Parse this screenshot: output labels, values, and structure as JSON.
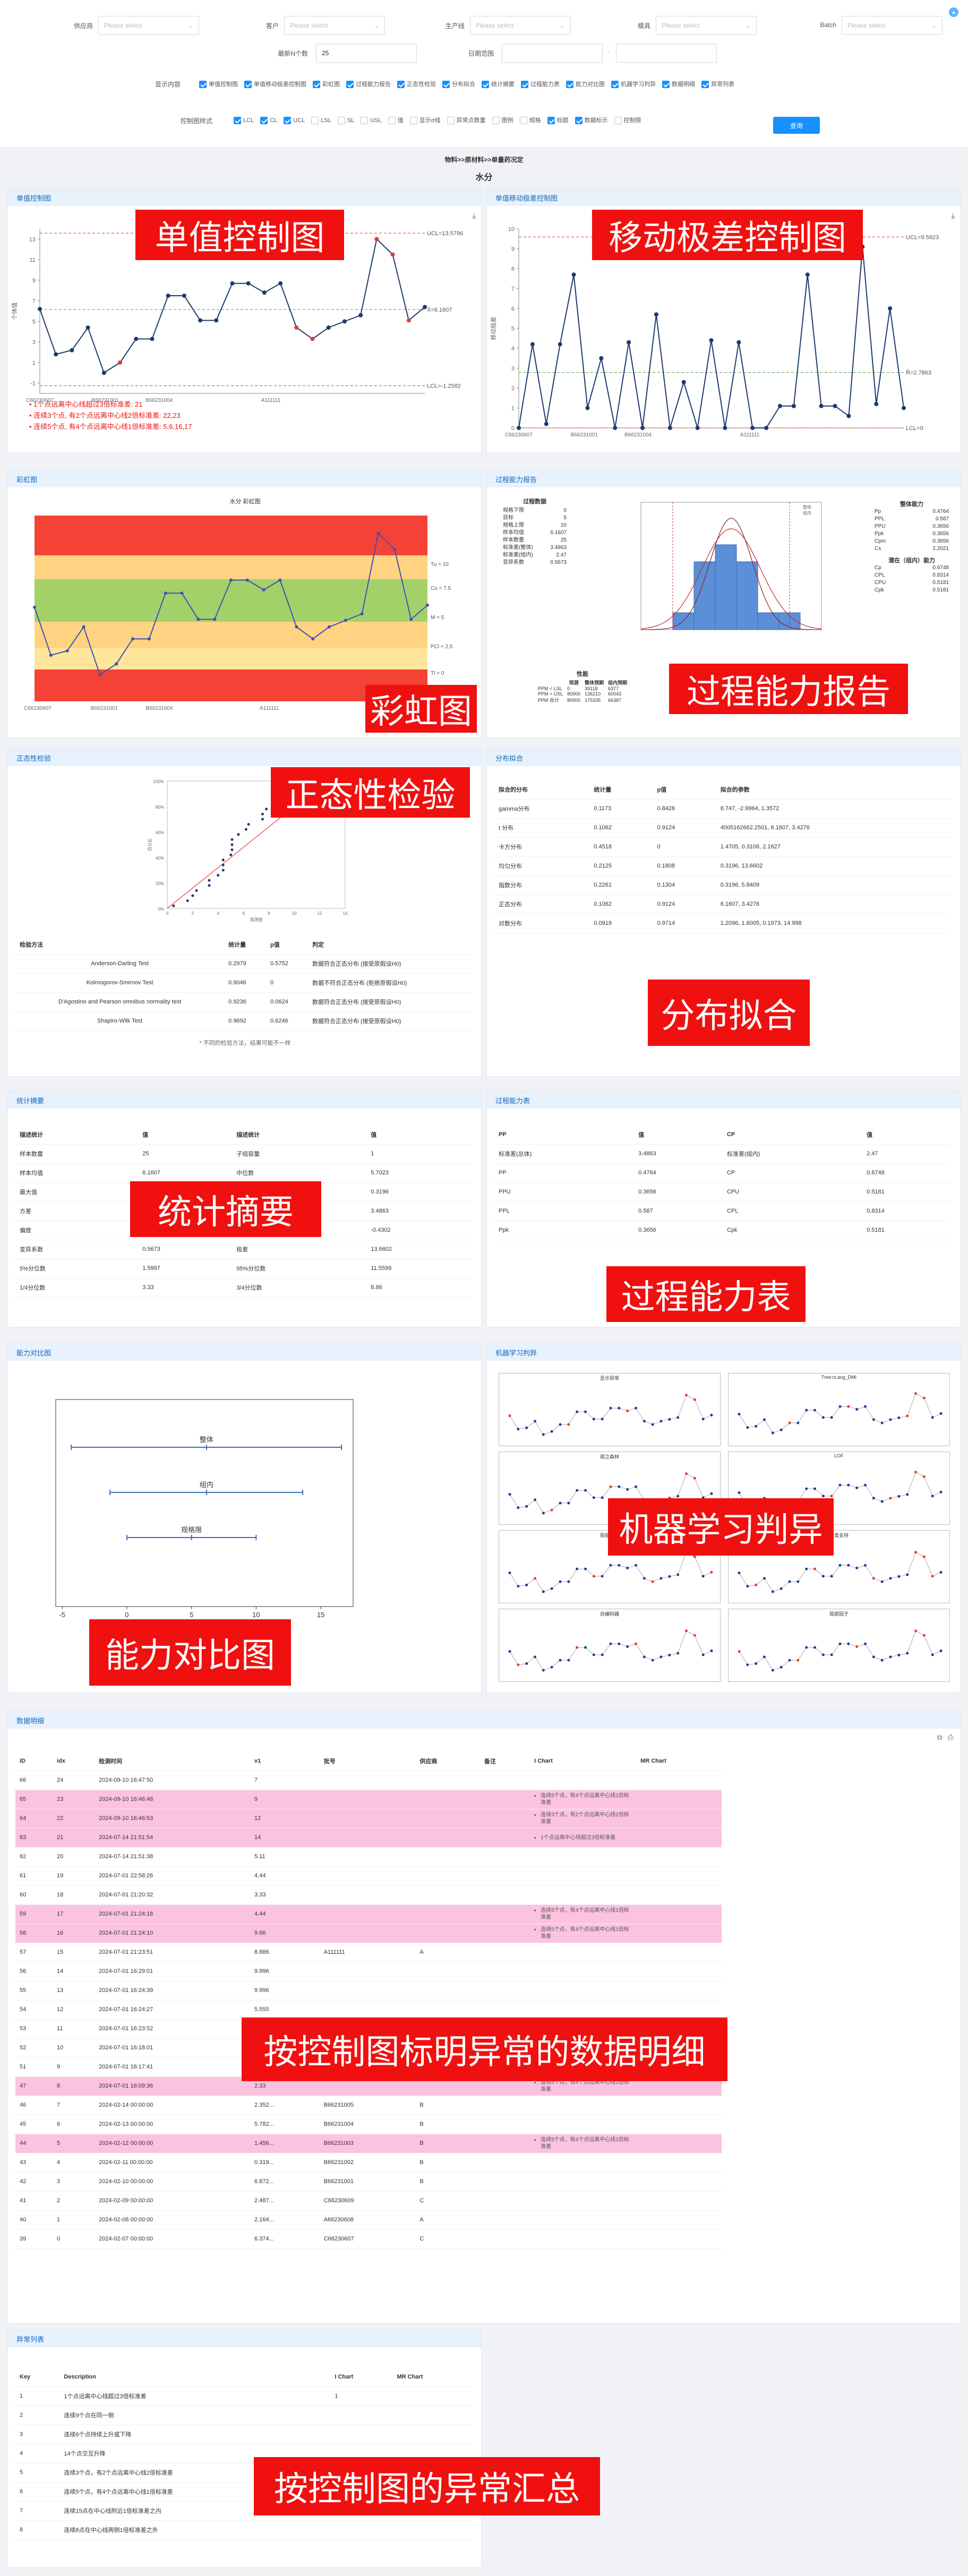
{
  "filters": {
    "row1": [
      {
        "label": "供应商",
        "placeholder": "Please select"
      },
      {
        "label": "客户",
        "placeholder": "Please select"
      },
      {
        "label": "生产线",
        "placeholder": "Please select"
      },
      {
        "label": "模具",
        "placeholder": "Please select"
      },
      {
        "label": "Batch",
        "placeholder": "Please select"
      }
    ],
    "recent_label": "最新N个数",
    "recent_value": "25",
    "date_label": "日期范围",
    "date_sep": "-",
    "display_label": "显示内容",
    "display_items": [
      "单值控制图",
      "单值移动极差控制图",
      "彩虹图",
      "过程能力报告",
      "正态性检验",
      "分布拟合",
      "统计摘要",
      "过程能力表",
      "能力对比图",
      "机器学习判异",
      "数据明细",
      "异常列表"
    ],
    "style_label": "控制图样式",
    "style_items": [
      {
        "label": "LCL",
        "on": true
      },
      {
        "label": "CL",
        "on": true
      },
      {
        "label": "UCL",
        "on": true
      },
      {
        "label": "LSL",
        "on": false
      },
      {
        "label": "SL",
        "on": false
      },
      {
        "label": "USL",
        "on": false
      },
      {
        "label": "值",
        "on": false
      },
      {
        "label": "显示σ线",
        "on": false
      },
      {
        "label": "异常点数量",
        "on": false
      },
      {
        "label": "图例",
        "on": false
      },
      {
        "label": "规格",
        "on": false
      },
      {
        "label": "标题",
        "on": true
      },
      {
        "label": "数据标示",
        "on": true
      },
      {
        "label": "控制限",
        "on": false
      }
    ],
    "query_btn": "查询"
  },
  "breadcrumb": "物料>>原材料>>单量药况定",
  "subtitle": "水分",
  "overlay_labels": {
    "i_chart": "单值控制图",
    "mr_chart": "移动极差控制图",
    "rainbow": "彩虹图",
    "capability_report": "过程能力报告",
    "normality": "正态性检验",
    "dist_fit": "分布拟合",
    "stats": "统计摘要",
    "cap_table": "过程能力表",
    "compare": "能力对比图",
    "ml": "机器学习判异",
    "detail": "按控制图标明异常的数据明细",
    "summary": "按控制图的异常汇总"
  },
  "colors": {
    "accent": "#1890ff",
    "overlay": "#f01010",
    "header_bg": "#e7f2fc",
    "pink": "#fbc3e0"
  },
  "i_chart": {
    "title": "单值控制图",
    "ylabel": "个体值",
    "ucl_label": "UCL=13.5796",
    "cl_label": "X̄=6.1607",
    "lcl_label": "LCL=-1.2582",
    "ucl": 13.5796,
    "cl": 6.1607,
    "lcl": -1.2582,
    "ylim": [
      -2,
      14
    ],
    "yticks": [
      -1,
      1,
      3,
      5,
      7,
      9,
      11,
      13
    ],
    "xticks": [
      "C66230607",
      "B66231001",
      "B66231004",
      "A111111"
    ],
    "values": [
      6.2,
      1.8,
      2.2,
      4.4,
      0,
      1,
      3.3,
      3.3,
      7.5,
      7.5,
      5.1,
      5.1,
      8.7,
      8.7,
      7.8,
      8.7,
      4.4,
      3.3,
      4.4,
      5,
      5.6,
      13,
      11.5,
      5.1,
      6.4
    ],
    "outliers": [
      5,
      16,
      17,
      21,
      22,
      23
    ],
    "messages": [
      "1个点远离中心线超过3倍标准差: 21",
      "连续3个点, 有2个点远离中心线2倍标准差: 22,23",
      "连续5个点, 有4个点远离中心线1倍标准差: 5,6,16,17"
    ]
  },
  "mr_chart": {
    "title": "单值移动极差控制图",
    "ylabel": "移动极差",
    "ucl_label": "UCL=9.5923",
    "cl_label": "R̄=2.7863",
    "lcl_label": "LCL=0",
    "ucl": 9.5923,
    "cl": 2.7863,
    "lcl": 0,
    "ylim": [
      0,
      10
    ],
    "yticks": [
      0,
      1,
      2,
      3,
      4,
      5,
      6,
      7,
      8,
      9,
      10
    ],
    "xticks": [
      "C66230607",
      "B66231001",
      "B66231004",
      "A111111"
    ],
    "values": [
      0,
      4.2,
      0.2,
      4.2,
      7.7,
      1,
      3.5,
      0,
      4.3,
      0,
      5.7,
      0,
      2.3,
      0,
      4.4,
      0,
      4.3,
      0,
      0,
      1.1,
      1.1,
      7.7,
      1.1,
      1.1,
      0.6,
      9.1,
      1.2,
      6,
      1
    ]
  },
  "rainbow": {
    "title": "彩虹图",
    "inner_title": "水分 彩虹图",
    "band_labels": [
      "Tu = 10",
      "Cu = 7.5",
      "M = 5",
      "PCl = 2.5",
      "Tl = 0"
    ],
    "xticks": [
      "C66230607",
      "B66231001",
      "B66231004",
      "A111111"
    ],
    "values": [
      6.2,
      1.8,
      2.2,
      4.4,
      0,
      1,
      3.3,
      3.3,
      7.5,
      7.5,
      5.1,
      5.1,
      8.7,
      8.7,
      7.8,
      8.7,
      4.4,
      3.3,
      4.4,
      5,
      5.6,
      13,
      11.5,
      5.1,
      6.4
    ]
  },
  "capability_report": {
    "title": "过程能力报告",
    "left_heading": "过程数据",
    "left_rows": [
      [
        "规格下限",
        "0"
      ],
      [
        "目标",
        "5"
      ],
      [
        "规格上限",
        "10"
      ],
      [
        "样本均值",
        "6.1607"
      ],
      [
        "样本数量",
        "25"
      ],
      [
        "标准差(整体)",
        "3.4863"
      ],
      [
        "标准差(组内)",
        "2.47"
      ],
      [
        "变异系数",
        "0.5673"
      ]
    ],
    "right_heading1": "整体能力",
    "right_rows1": [
      [
        "Pp",
        "0.4764"
      ],
      [
        "PPL",
        "0.587"
      ],
      [
        "PPU",
        "0.3656"
      ],
      [
        "Ppk",
        "0.3656"
      ],
      [
        "Cpm",
        "0.3656"
      ],
      [
        "Cs",
        "2.2021"
      ]
    ],
    "right_heading2": "潜在（组内）能力",
    "right_rows2": [
      [
        "Cp",
        "0.6748"
      ],
      [
        "CPL",
        "0.8314"
      ],
      [
        "CPU",
        "0.5181"
      ],
      [
        "Cpk",
        "0.5181"
      ]
    ],
    "perf_heading": "性能",
    "perf_cols": [
      "",
      "观测",
      "整体预期",
      "组内预期"
    ],
    "perf_rows": [
      [
        "PPM < LSL",
        "0",
        "39118",
        "6377"
      ],
      [
        "PPM > USL",
        "80000",
        "136210",
        "60043"
      ],
      [
        "PPM 合计",
        "80000",
        "175335",
        "66387"
      ]
    ],
    "histogram": [
      1,
      4,
      5,
      4,
      1,
      1
    ],
    "legend": [
      "整体",
      "组内"
    ]
  },
  "normality": {
    "title": "正态性检验",
    "ylabel": "百分比",
    "xlabel": "观测值",
    "yticks": [
      "100%",
      "80%",
      "60%",
      "40%",
      "20%",
      "0%"
    ],
    "xticks": [
      "0",
      "2",
      "4",
      "6",
      "8",
      "10",
      "12",
      "14"
    ],
    "points": [
      [
        0.5,
        2
      ],
      [
        1.6,
        6
      ],
      [
        2,
        10
      ],
      [
        2.3,
        14
      ],
      [
        3.3,
        18
      ],
      [
        3.3,
        22
      ],
      [
        4,
        26
      ],
      [
        4.4,
        30
      ],
      [
        4.4,
        34
      ],
      [
        4.4,
        38
      ],
      [
        5,
        42
      ],
      [
        5.1,
        46
      ],
      [
        5.1,
        50
      ],
      [
        5.1,
        54
      ],
      [
        5.6,
        58
      ],
      [
        6.2,
        62
      ],
      [
        6.4,
        66
      ],
      [
        7.5,
        70
      ],
      [
        7.5,
        74
      ],
      [
        7.8,
        78
      ],
      [
        8.7,
        82
      ],
      [
        8.7,
        86
      ],
      [
        8.7,
        90
      ],
      [
        11.5,
        94
      ],
      [
        13,
        98
      ]
    ],
    "cols": [
      "检验方法",
      "统计量",
      "p值",
      "判定"
    ],
    "rows": [
      [
        "Anderson-Darling Test",
        "0.2979",
        "0.5752",
        "数据符合正态分布 (接受原假设H0)"
      ],
      [
        "Kolmogorov-Smirnov Test",
        "0.9046",
        "0",
        "数据不符合正态分布 (拒绝原假设H0)"
      ],
      [
        "D'Agostino and Pearson omnibus normality test",
        "0.9236",
        "0.0624",
        "数据符合正态分布 (接受原假设H0)"
      ],
      [
        "Shapiro-Wilk Test",
        "0.9692",
        "0.6246",
        "数据符合正态分布 (接受原假设H0)"
      ]
    ],
    "note": "* 不同的检验方法，结果可能不一样"
  },
  "dist_fit": {
    "title": "分布拟合",
    "cols": [
      "拟合的分布",
      "统计量",
      "p值",
      "拟合的参数"
    ],
    "rows": [
      [
        "gamma分布",
        "0.1173",
        "0.8426",
        "6.747, -2.9964, 1.3572"
      ],
      [
        "t 分布",
        "0.1062",
        "0.9124",
        "4005162662.2501, 6.1607, 3.4276"
      ],
      [
        "卡方分布",
        "0.4518",
        "0",
        "1.4705, 0.3106, 2.1627"
      ],
      [
        "均匀分布",
        "0.2125",
        "0.1808",
        "0.3196, 13.6602"
      ],
      [
        "指数分布",
        "0.2261",
        "0.1304",
        "0.3196, 5.8409"
      ],
      [
        "正态分布",
        "0.1062",
        "0.9124",
        "6.1607, 3.4276"
      ],
      [
        "对数分布",
        "0.0919",
        "0.9714",
        "1.2096, 1.6005, 0.1973, 14.998"
      ]
    ]
  },
  "stats": {
    "title": "统计摘要",
    "cols": [
      "描述统计",
      "值",
      "描述统计",
      "值"
    ],
    "rows": [
      [
        "样本数量",
        "25",
        "子组容量",
        "1"
      ],
      [
        "样本均值",
        "6.1607",
        "中位数",
        "5.7023"
      ],
      [
        "最大值",
        "0",
        "最小值",
        "0.3196"
      ],
      [
        "方差",
        "",
        "标准差",
        "3.4863"
      ],
      [
        "偏度",
        "0.3889",
        "峰度",
        "-0.4302"
      ],
      [
        "变异系数",
        "0.5673",
        "极差",
        "13.6602"
      ],
      [
        "5%分位数",
        "1.5997",
        "95%分位数",
        "11.5599"
      ],
      [
        "1/4分位数",
        "3.33",
        "3/4分位数",
        "8.86"
      ]
    ]
  },
  "cap_table": {
    "title": "过程能力表",
    "cols": [
      "PP",
      "值",
      "CP",
      "值"
    ],
    "rows": [
      [
        "标准差(总体)",
        "3.4863",
        "标准差(组内)",
        "2.47"
      ],
      [
        "PP",
        "0.4764",
        "CP",
        "0.6748"
      ],
      [
        "PPU",
        "0.3656",
        "CPU",
        "0.5181"
      ],
      [
        "PPL",
        "0.587",
        "CPL",
        "0.8314"
      ],
      [
        "Ppk",
        "0.3656",
        "Cpk",
        "0.5181"
      ]
    ]
  },
  "compare": {
    "title": "能力对比图",
    "bars": [
      {
        "label": "整体",
        "from": -4.3,
        "to": 16.6,
        "mid": 6.16
      },
      {
        "label": "组内",
        "from": -1.3,
        "to": 13.6,
        "mid": 6.16
      },
      {
        "label": "规格限",
        "from": 0,
        "to": 10,
        "mid": 5
      }
    ],
    "xticks": [
      "-5",
      "0",
      "5",
      "10",
      "15"
    ]
  },
  "ml": {
    "title": "机器学习判异",
    "panels": [
      "显示异常",
      "Tree:ct.avg_DMI",
      "孤立森林",
      "LOF",
      "局部离群",
      "单类支持",
      "自编码器",
      "局部因子"
    ]
  },
  "detail": {
    "title": "数据明细",
    "cols": [
      "ID",
      "idx",
      "检测时间",
      "v1",
      "批号",
      "供应商",
      "备注",
      "I Chart",
      "MR Chart"
    ],
    "rows": [
      {
        "c": [
          "66",
          "24",
          "2024-09-10 16:47:50",
          "7",
          "",
          "",
          "",
          ""
        ],
        "pink": false,
        "notes": []
      },
      {
        "c": [
          "65",
          "23",
          "2024-09-10 16:46:48",
          "9",
          "",
          "",
          "",
          ""
        ],
        "pink": true,
        "notes": [
          "连续5个点，有4个点远离中心线1倍标准差"
        ]
      },
      {
        "c": [
          "64",
          "22",
          "2024-09-10 16:46:53",
          "12",
          "",
          "",
          "",
          ""
        ],
        "pink": true,
        "notes": [
          "连续3个点，有2个点远离中心线2倍标准差"
        ]
      },
      {
        "c": [
          "63",
          "21",
          "2024-07-14 21:51:54",
          "14",
          "",
          "",
          "",
          ""
        ],
        "pink": true,
        "notes": [
          "1个点远离中心线超过3倍标准差"
        ]
      },
      {
        "c": [
          "62",
          "20",
          "2024-07-14 21:51:38",
          "5.11",
          "",
          "",
          "",
          ""
        ],
        "pink": false,
        "notes": []
      },
      {
        "c": [
          "61",
          "19",
          "2024-07-01 22:58:26",
          "4.44",
          "",
          "",
          "",
          ""
        ],
        "pink": false,
        "notes": []
      },
      {
        "c": [
          "60",
          "18",
          "2024-07-01 21:20:32",
          "3.33",
          "",
          "",
          "",
          ""
        ],
        "pink": false,
        "notes": []
      },
      {
        "c": [
          "59",
          "17",
          "2024-07-01 21:24:18",
          "4.44",
          "",
          "",
          "",
          ""
        ],
        "pink": true,
        "notes": [
          "连续5个点，有4个点远离中心线1倍标准差"
        ]
      },
      {
        "c": [
          "58",
          "16",
          "2024-07-01 21:24:10",
          "9.66",
          "",
          "",
          "",
          ""
        ],
        "pink": true,
        "notes": [
          "连续5个点，有4个点远离中心线1倍标准差"
        ]
      },
      {
        "c": [
          "57",
          "15",
          "2024-07-01 21:23:51",
          "8.886",
          "A111111",
          "A",
          "",
          ""
        ],
        "pink": false,
        "notes": []
      },
      {
        "c": [
          "56",
          "14",
          "2024-07-01 16:29:01",
          "9.996",
          "",
          "",
          "",
          ""
        ],
        "pink": false,
        "notes": []
      },
      {
        "c": [
          "55",
          "13",
          "2024-07-01 16:24:39",
          "9.996",
          "",
          "",
          "",
          ""
        ],
        "pink": false,
        "notes": []
      },
      {
        "c": [
          "54",
          "12",
          "2024-07-01 16:24:27",
          "5.555",
          "",
          "",
          "",
          ""
        ],
        "pink": false,
        "notes": []
      },
      {
        "c": [
          "53",
          "11",
          "2024-07-01 16:23:52",
          "5.555",
          "",
          "",
          "",
          ""
        ],
        "pink": false,
        "notes": []
      },
      {
        "c": [
          "52",
          "10",
          "2024-07-01 16:18:01",
          "9.66",
          "",
          "",
          "",
          ""
        ],
        "pink": false,
        "notes": []
      },
      {
        "c": [
          "51",
          "9",
          "2024-07-01 16:17:41",
          "9.66",
          "",
          "",
          "",
          ""
        ],
        "pink": false,
        "notes": []
      },
      {
        "c": [
          "47",
          "8",
          "2024-07-01 16:09:36",
          "2.33",
          "",
          "",
          "",
          ""
        ],
        "pink": true,
        "notes": [
          "连续5个点，有4个点远离中心线1倍标准差"
        ]
      },
      {
        "c": [
          "46",
          "7",
          "2024-02-14 00:00:00",
          "2.352...",
          "B66231005",
          "B",
          "",
          ""
        ],
        "pink": false,
        "notes": []
      },
      {
        "c": [
          "45",
          "6",
          "2024-02-13 00:00:00",
          "5.782...",
          "B66231004",
          "B",
          "",
          ""
        ],
        "pink": false,
        "notes": []
      },
      {
        "c": [
          "44",
          "5",
          "2024-02-12 00:00:00",
          "1.456...",
          "B66231003",
          "B",
          "",
          ""
        ],
        "pink": true,
        "notes": [
          "连续5个点，有4个点远离中心线1倍标准差"
        ]
      },
      {
        "c": [
          "43",
          "4",
          "2024-02-11 00:00:00",
          "0.319...",
          "B66231002",
          "B",
          "",
          ""
        ],
        "pink": false,
        "notes": []
      },
      {
        "c": [
          "42",
          "3",
          "2024-02-10 00:00:00",
          "6.872...",
          "B66231001",
          "B",
          "",
          ""
        ],
        "pink": false,
        "notes": []
      },
      {
        "c": [
          "41",
          "2",
          "2024-02-09 00:00:00",
          "2.487...",
          "C66230609",
          "C",
          "",
          ""
        ],
        "pink": false,
        "notes": []
      },
      {
        "c": [
          "40",
          "1",
          "2024-02-08 00:00:00",
          "2.164...",
          "A66230608",
          "A",
          "",
          ""
        ],
        "pink": false,
        "notes": []
      },
      {
        "c": [
          "39",
          "0",
          "2024-02-07 00:00:00",
          "6.374...",
          "C66230607",
          "C",
          "",
          ""
        ],
        "pink": false,
        "notes": []
      }
    ]
  },
  "summary": {
    "title": "异常列表",
    "cols": [
      "Key",
      "Description",
      "I Chart",
      "MR Chart"
    ],
    "rows": [
      [
        "1",
        "1个点远离中心线超过3倍标准差",
        "1",
        ""
      ],
      [
        "2",
        "连续9个点在同一侧",
        "",
        ""
      ],
      [
        "3",
        "连续6个点持续上升或下降",
        "",
        ""
      ],
      [
        "4",
        "14个点交互升降",
        "",
        ""
      ],
      [
        "5",
        "连续3个点，有2个点远离中心线2倍标准差",
        "2",
        ""
      ],
      [
        "6",
        "连续5个点，有4个点远离中心线1倍标准差",
        "4",
        ""
      ],
      [
        "7",
        "连续15点在中心线附近1倍标准差之内",
        "",
        ""
      ],
      [
        "8",
        "连续8点在中心线两侧1倍标准差之外",
        "",
        ""
      ]
    ]
  }
}
